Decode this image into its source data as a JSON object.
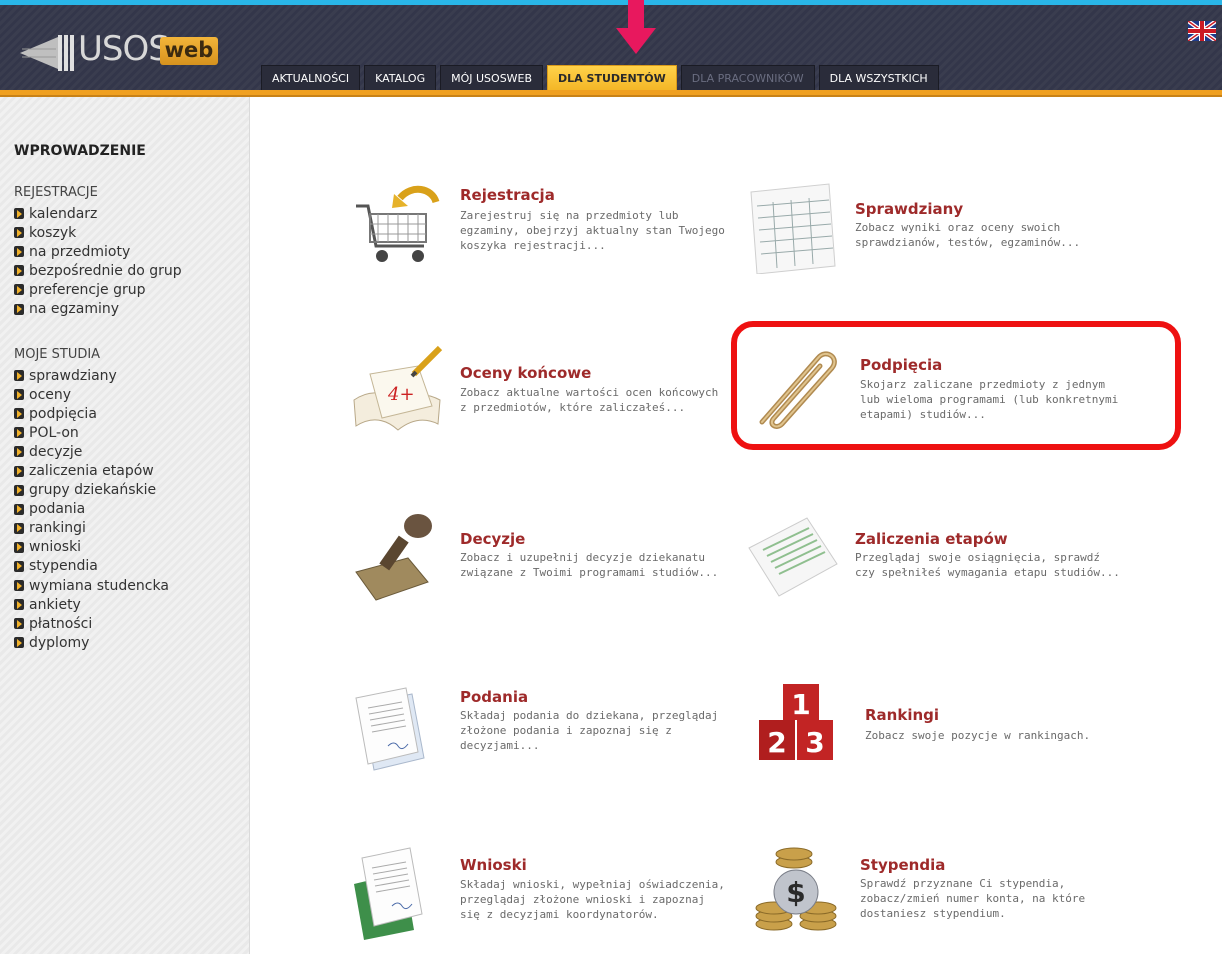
{
  "header": {
    "logo_text": "USOS",
    "logo_badge": "web",
    "language_flag": "uk-flag-icon",
    "tabs": [
      {
        "label": "AKTUALNOŚCI",
        "state": "normal"
      },
      {
        "label": "KATALOG",
        "state": "normal"
      },
      {
        "label": "MÓJ USOSWEB",
        "state": "normal"
      },
      {
        "label": "DLA STUDENTÓW",
        "state": "active"
      },
      {
        "label": "DLA PRACOWNIKÓW",
        "state": "disabled"
      },
      {
        "label": "DLA WSZYSTKICH",
        "state": "normal"
      }
    ]
  },
  "sidebar": {
    "heading": "WPROWADZENIE",
    "sections": [
      {
        "title": "REJESTRACJE",
        "items": [
          "kalendarz",
          "koszyk",
          "na przedmioty",
          "bezpośrednie do grup",
          "preferencje grup",
          "na egzaminy"
        ]
      },
      {
        "title": "MOJE STUDIA",
        "items": [
          "sprawdziany",
          "oceny",
          "podpięcia",
          "POL-on",
          "decyzje",
          "zaliczenia etapów",
          "grupy dziekańskie",
          "podania",
          "rankingi",
          "wnioski",
          "stypendia",
          "wymiana studencka",
          "ankiety",
          "płatności",
          "dyplomy"
        ]
      }
    ]
  },
  "tiles": [
    {
      "title": "Rejestracja",
      "icon": "shopping-cart-icon",
      "desc": "Zarejestruj się na przedmioty lub egzaminy, obejrzyj aktualny stan Twojego koszyka rejestracji..."
    },
    {
      "title": "Sprawdziany",
      "icon": "test-sheet-icon",
      "desc": "Zobacz wyniki oraz oceny swoich sprawdzianów, testów, egzaminów..."
    },
    {
      "title": "Oceny końcowe",
      "icon": "grade-notebook-icon",
      "desc": "Zobacz aktualne wartości ocen końcowych z przedmiotów, które zaliczałeś..."
    },
    {
      "title": "Podpięcia",
      "icon": "paperclip-icon",
      "desc": "Skojarz zaliczane przedmioty z jednym lub wieloma programami (lub konkretnymi etapami) studiów..."
    },
    {
      "title": "Decyzje",
      "icon": "stamp-icon",
      "desc": "Zobacz i uzupełnij decyzje dziekanatu związane z Twoimi programami studiów..."
    },
    {
      "title": "Zaliczenia etapów",
      "icon": "report-sheet-icon",
      "desc": "Przeglądaj swoje osiągnięcia, sprawdź czy spełniłeś wymagania etapu studiów..."
    },
    {
      "title": "Podania",
      "icon": "documents-icon",
      "desc": "Składaj podania do dziekana, przeglądaj złożone podania i zapoznaj się z decyzjami..."
    },
    {
      "title": "Rankingi",
      "icon": "podium-icon",
      "desc": "Zobacz swoje pozycje w rankingach."
    },
    {
      "title": "Wnioski",
      "icon": "application-documents-icon",
      "desc": "Składaj wnioski, wypełniaj oświadczenia, przeglądaj złożone wnioski i zapoznaj się z decyzjami koordynatorów."
    },
    {
      "title": "Stypendia",
      "icon": "coins-dollar-icon",
      "desc": "Sprawdź przyznane Ci stypendia, zobacz/zmień numer konta, na które dostaniesz stypendium."
    }
  ],
  "podium_numbers": [
    "1",
    "2",
    "3"
  ],
  "grade_text": "4+",
  "colors": {
    "accent_orange": "#f0a020",
    "header_bg": "#3a3d4f",
    "tile_title": "#9e2a2a",
    "highlight_red": "#ee1111",
    "arrow_pink": "#e8185e",
    "top_strip": "#29b6e8"
  }
}
